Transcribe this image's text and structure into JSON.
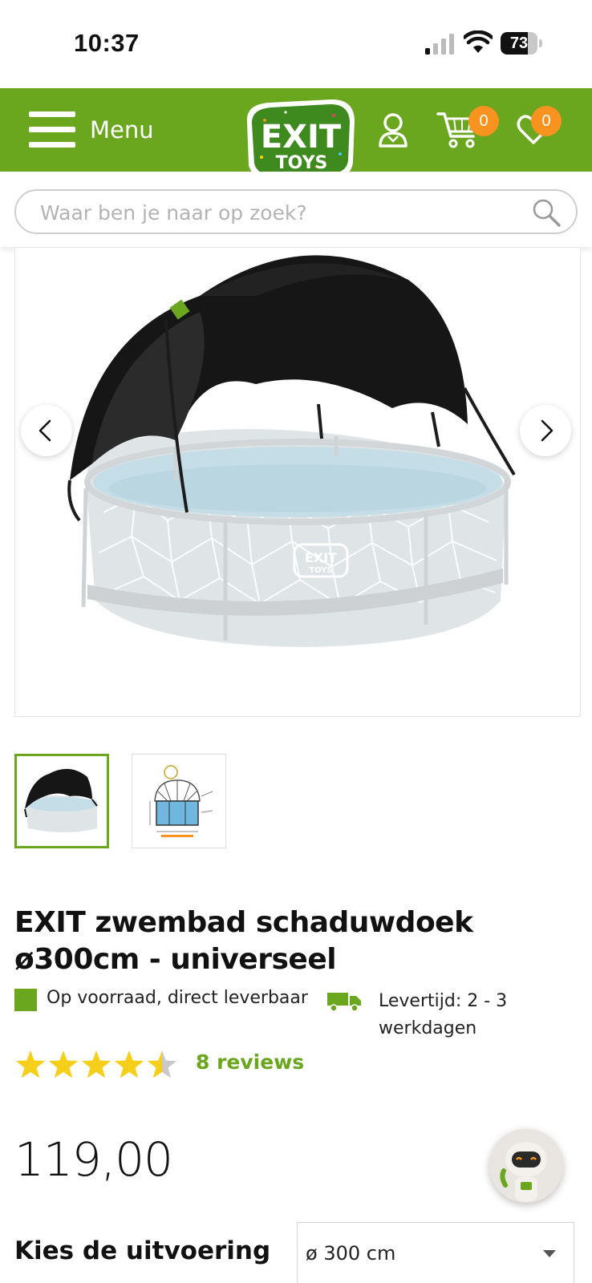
{
  "status_bar": {
    "time": "10:37",
    "battery": "73",
    "battery_level": 0.73
  },
  "header": {
    "menu_label": "Menu",
    "logo_top": "EXIT",
    "logo_bottom": "TOYS",
    "cart_count": "0",
    "wishlist_count": "0",
    "brand_color": "#6aa61e",
    "badge_color": "#f7931e"
  },
  "search": {
    "placeholder": "Waar ben je naar op zoek?",
    "value": ""
  },
  "gallery": {
    "main_image": "pool-with-shade-canopy",
    "thumbnails": [
      "pool-with-shade-canopy",
      "dimensions-diagram"
    ],
    "selected_thumbnail": 0
  },
  "product": {
    "title": "EXIT zwembad schaduwdoek ø300cm - universeel",
    "stock_text": "Op voorraad, direct leverbaar",
    "delivery_text": "Levertijd: 2 - 3 werkdagen",
    "rating": 4.5,
    "rating_max": 5,
    "reviews_label": "8 reviews",
    "price": "119,00"
  },
  "variant": {
    "label": "Kies de uitvoering",
    "selected": "ø 300 cm"
  }
}
